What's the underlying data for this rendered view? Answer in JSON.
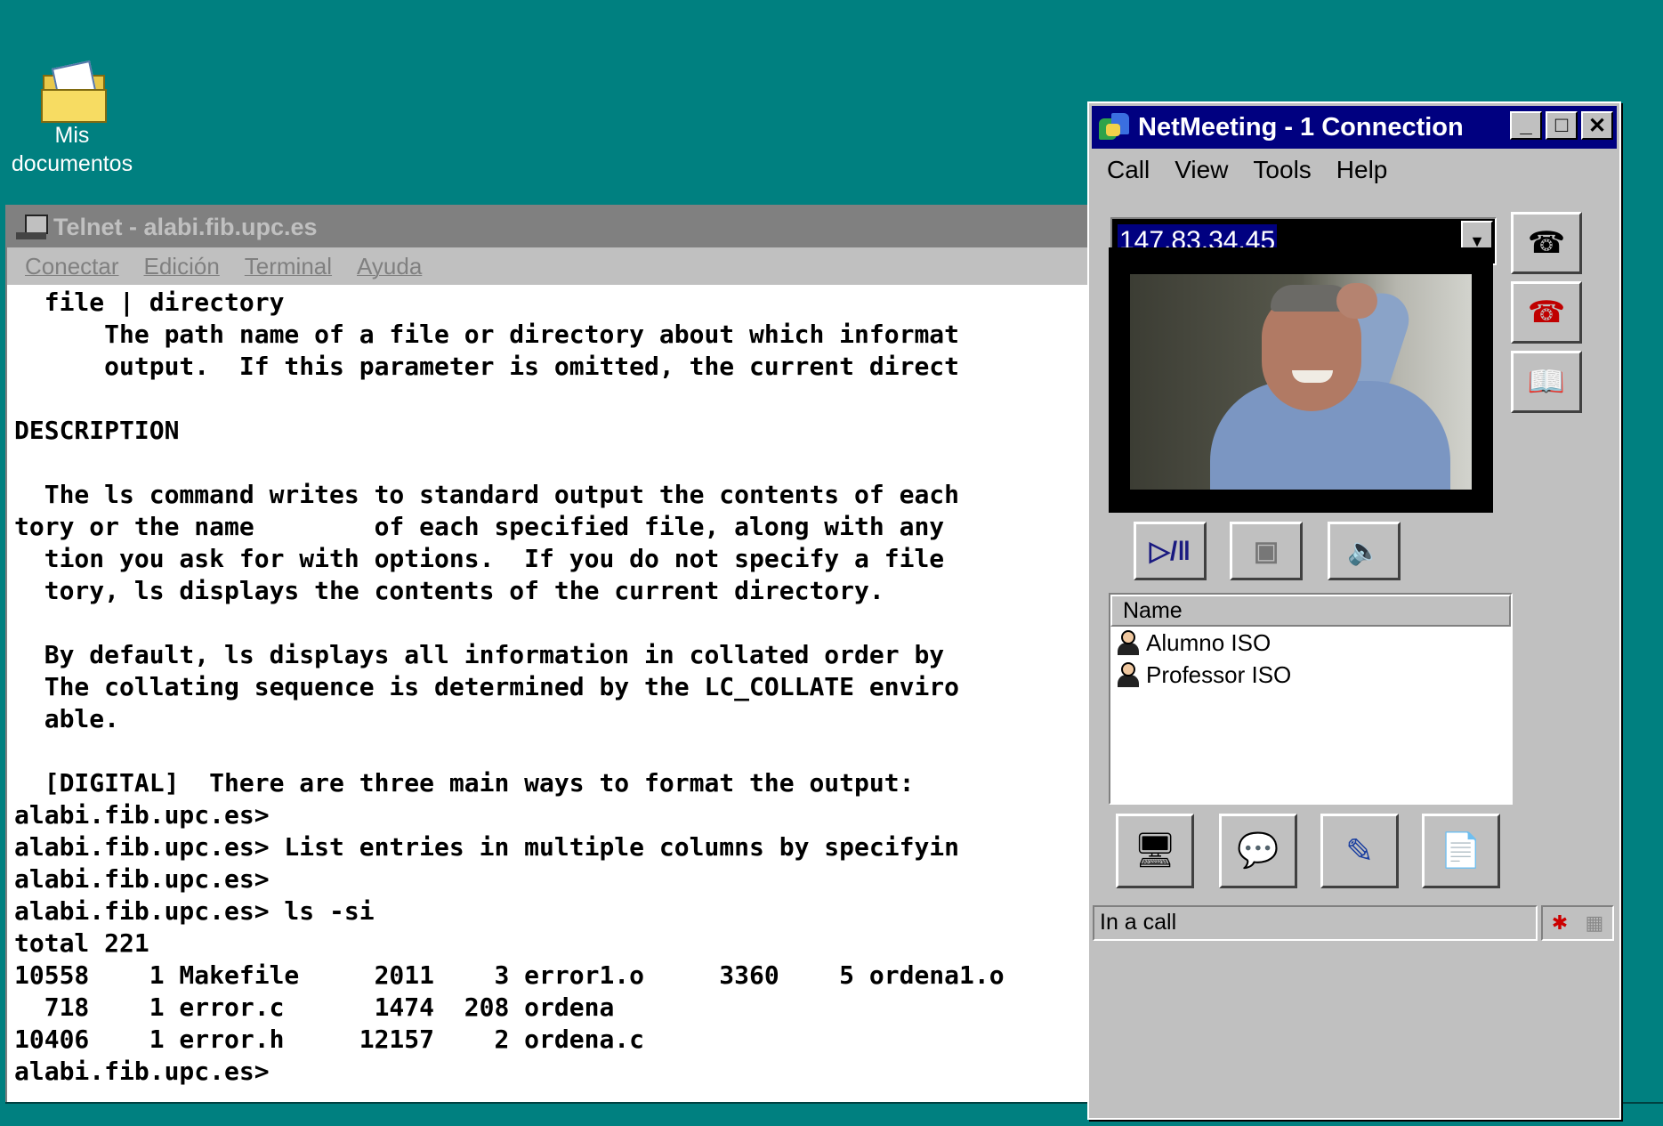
{
  "desktop": {
    "icon_label_line1": "Mis",
    "icon_label_line2": "documentos"
  },
  "telnet": {
    "title": "Telnet - alabi.fib.upc.es",
    "menu": [
      "Conectar",
      "Edición",
      "Terminal",
      "Ayuda"
    ],
    "lines": [
      "  file | directory",
      "      The path name of a file or directory about which informat",
      "      output.  If this parameter is omitted, the current direct",
      "",
      "DESCRIPTION",
      "",
      "  The ls command writes to standard output the contents of each",
      "tory or the name        of each specified file, along with any",
      "  tion you ask for with options.  If you do not specify a file",
      "  tory, ls displays the contents of the current directory.",
      "",
      "  By default, ls displays all information in collated order by",
      "  The collating sequence is determined by the LC_COLLATE enviro",
      "  able.",
      "",
      "  [DIGITAL]  There are three main ways to format the output:",
      "alabi.fib.upc.es>",
      "alabi.fib.upc.es> List entries in multiple columns by specifyin",
      "alabi.fib.upc.es>",
      "alabi.fib.upc.es> ls -si",
      "total 221",
      "10558    1 Makefile     2011    3 error1.o     3360    5 ordena1.o",
      "  718    1 error.c      1474  208 ordena",
      "10406    1 error.h     12157    2 ordena.c",
      "alabi.fib.upc.es>"
    ]
  },
  "netmeeting": {
    "title": "NetMeeting - 1 Connection",
    "menu": [
      "Call",
      "View",
      "Tools",
      "Help"
    ],
    "address": "147.83.34.45",
    "list_header": "Name",
    "participants": [
      "Alumno ISO",
      "Professor ISO"
    ],
    "status": "In a call"
  },
  "icons": {
    "dial": "phone-dial-icon",
    "hangup": "hang-up-icon",
    "directory": "address-book-icon",
    "play_pause": "play-pause-icon",
    "picture_in_picture": "picture-in-picture-icon",
    "audio": "audio-tuning-icon",
    "share": "share-program-icon",
    "chat": "chat-icon",
    "whiteboard": "whiteboard-icon",
    "file_transfer": "file-transfer-icon"
  }
}
